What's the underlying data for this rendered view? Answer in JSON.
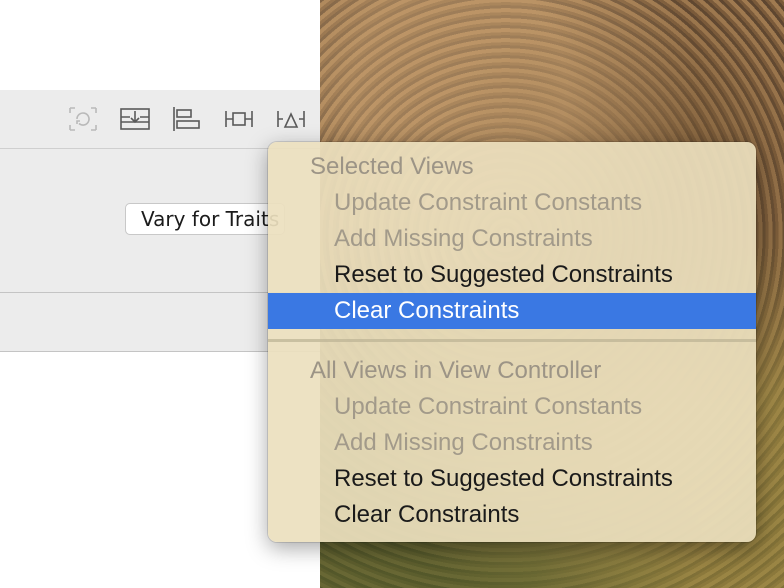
{
  "xcode": {
    "vary_button_label": "Vary for Traits",
    "toolbar_icons": [
      "resolve-issues-icon",
      "embed-in-stack-icon",
      "align-icon",
      "add-constraints-icon",
      "resolve-autolayout-icon"
    ]
  },
  "menu": {
    "sections": [
      {
        "header": "Selected Views",
        "items": [
          {
            "label": "Update Constraint Constants",
            "enabled": false
          },
          {
            "label": "Add Missing Constraints",
            "enabled": false
          },
          {
            "label": "Reset to Suggested Constraints",
            "enabled": true
          },
          {
            "label": "Clear Constraints",
            "enabled": true,
            "selected": true
          }
        ]
      },
      {
        "header": "All Views in View Controller",
        "items": [
          {
            "label": "Update Constraint Constants",
            "enabled": false
          },
          {
            "label": "Add Missing Constraints",
            "enabled": false
          },
          {
            "label": "Reset to Suggested Constraints",
            "enabled": true
          },
          {
            "label": "Clear Constraints",
            "enabled": true
          }
        ]
      }
    ],
    "colors": {
      "highlight": "#3a78e3",
      "disabled_text": "#a29a8a",
      "enabled_text": "#1a1a1a"
    }
  }
}
